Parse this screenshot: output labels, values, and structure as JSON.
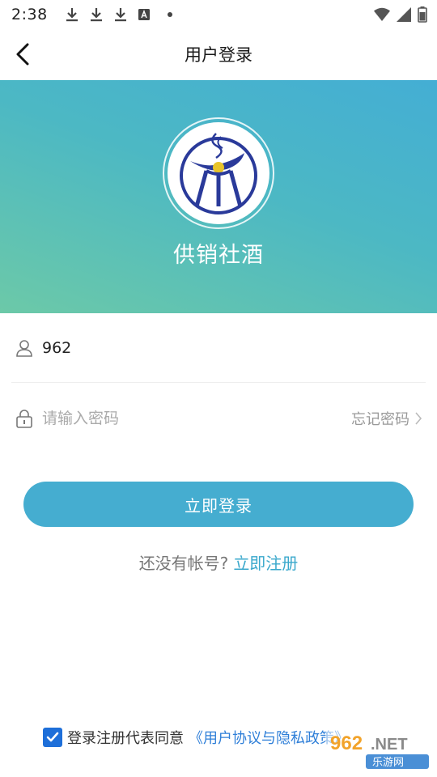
{
  "status_bar": {
    "time": "2:38"
  },
  "header": {
    "title": "用户登录"
  },
  "hero": {
    "app_name": "供销社酒"
  },
  "form": {
    "username_value": "962",
    "password_placeholder": "请输入密码",
    "forgot_label": "忘记密码",
    "login_button": "立即登录"
  },
  "register": {
    "question": "还没有帐号?",
    "link": "立即注册"
  },
  "agreement": {
    "checked": true,
    "text": "登录注册代表同意",
    "link": "《用户协议与隐私政策》"
  },
  "watermark": {
    "brand": "962.NET",
    "sub": "乐游网"
  },
  "colors": {
    "accent": "#45add0",
    "link": "#3aa8cc",
    "checkbox": "#1e6fd9"
  }
}
